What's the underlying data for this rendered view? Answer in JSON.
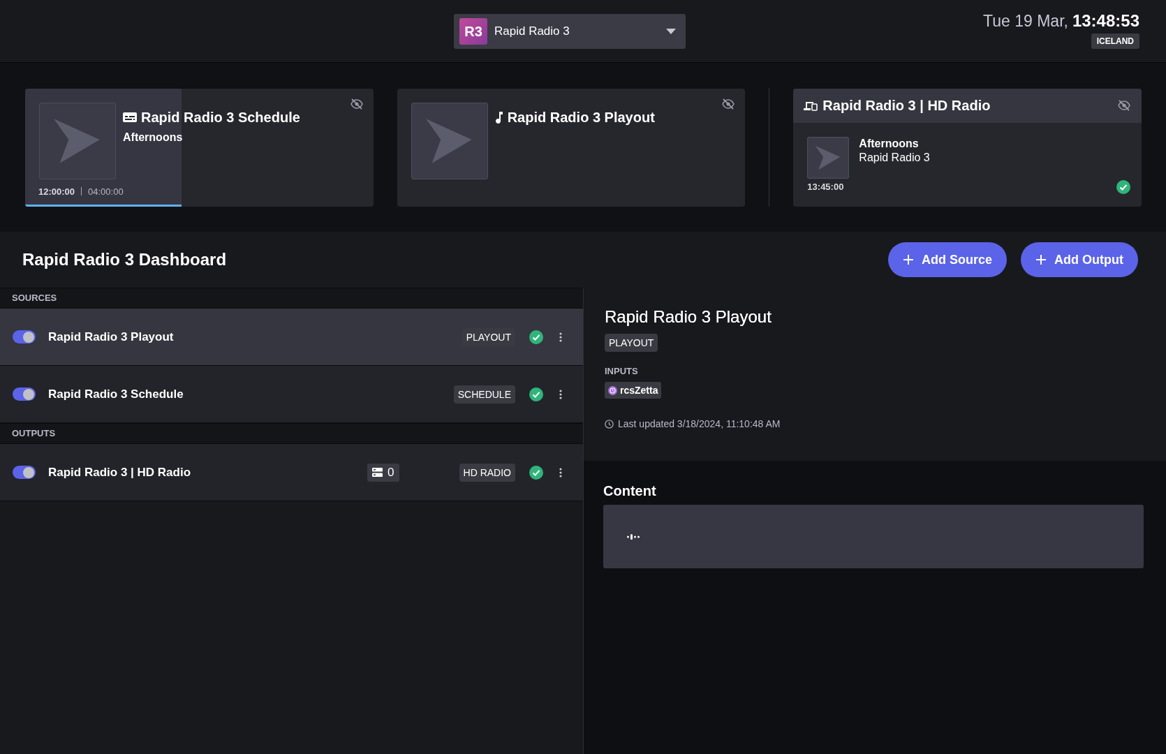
{
  "header": {
    "station": {
      "badge": "R3",
      "name": "Rapid Radio 3"
    },
    "date": "Tue 19 Mar,",
    "time": "13:48:53",
    "region": "ICELAND"
  },
  "cards": [
    {
      "kind": "schedule",
      "title": "Rapid Radio 3 Schedule",
      "subtitle": "Afternoons",
      "start": "12:00:00",
      "duration": "04:00:00",
      "level": 0.45
    },
    {
      "kind": "playout",
      "title": "Rapid Radio 3 Playout"
    },
    {
      "kind": "output",
      "title": "Rapid Radio 3 | HD Radio",
      "show": "Afternoons",
      "station": "Rapid Radio 3",
      "time": "13:45:00",
      "ok": true
    }
  ],
  "dashboard": {
    "title": "Rapid Radio 3 Dashboard",
    "actions": [
      "Add Source",
      "Add Output"
    ]
  },
  "sections": [
    {
      "heading": "SOURCES",
      "items": [
        {
          "name": "Rapid Radio 3 Playout",
          "on": true,
          "selected": true,
          "type": "PLAYOUT",
          "ok": true
        },
        {
          "name": "Rapid Radio 3 Schedule",
          "on": true,
          "selected": false,
          "type": "SCHEDULE",
          "ok": true
        }
      ]
    },
    {
      "heading": "OUTPUTS",
      "items": [
        {
          "name": "Rapid Radio 3 | HD Radio",
          "on": true,
          "selected": false,
          "count": "0",
          "type": "HD RADIO",
          "ok": true
        }
      ]
    }
  ],
  "detail": {
    "title": "Rapid Radio 3 Playout",
    "type": "PLAYOUT",
    "inputs_label": "INPUTS",
    "inputs": [
      "rcsZetta"
    ],
    "last_updated": "Last updated 3/18/2024, 11:10:48 AM"
  },
  "content": {
    "heading": "Content"
  }
}
